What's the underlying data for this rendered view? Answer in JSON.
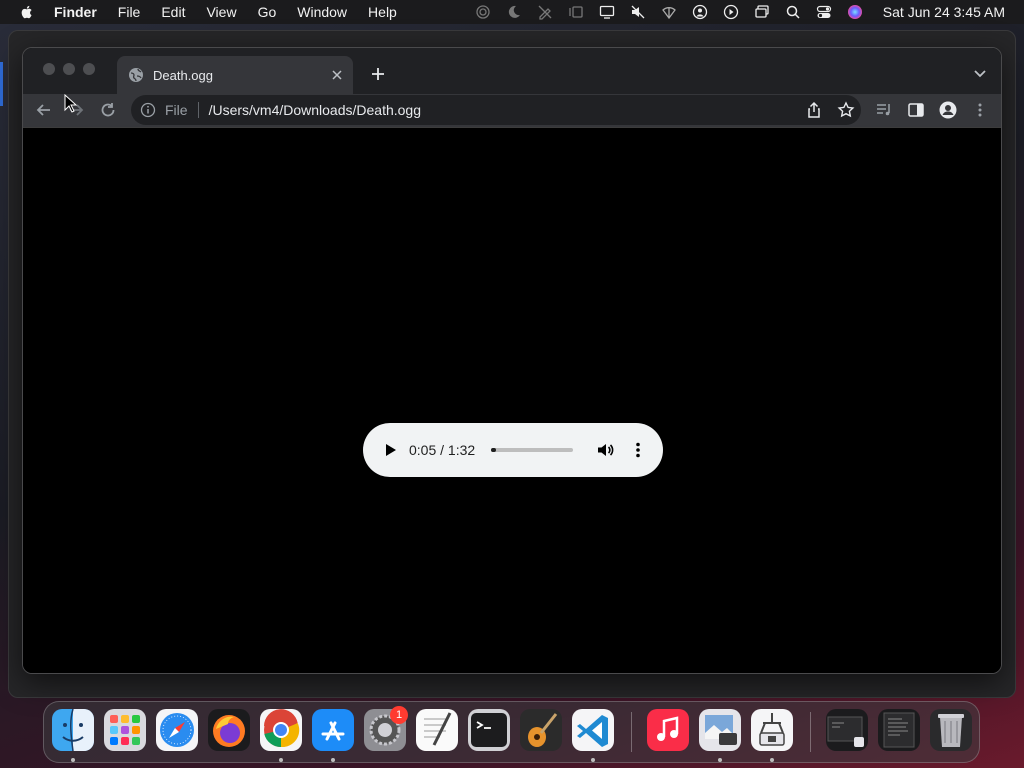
{
  "menubar": {
    "items": [
      "Finder",
      "File",
      "Edit",
      "View",
      "Go",
      "Window",
      "Help"
    ],
    "clock": "Sat Jun 24  3:45 AM",
    "status_icons": [
      "airdrop-icon",
      "focus-moon-icon",
      "pen-off-icon",
      "stage-manager-icon",
      "display-icon",
      "mute-icon",
      "wifi-icon",
      "user-icon",
      "play-circle-icon",
      "screens-icon",
      "search-icon",
      "control-center-icon",
      "siri-icon"
    ]
  },
  "browser": {
    "tab_title": "Death.ogg",
    "omnibox": {
      "scheme": "File",
      "url": "/Users/vm4/Downloads/Death.ogg"
    }
  },
  "player": {
    "time": "0:05 / 1:32",
    "progress": 0.054
  },
  "dock": {
    "apps": [
      "Finder",
      "Launchpad",
      "Safari",
      "Firefox",
      "Google Chrome",
      "App Store",
      "System Settings",
      "TextEdit",
      "Terminal",
      "GarageBand",
      "Visual Studio Code",
      "Music",
      "Preview",
      "Archive Utility",
      "Window 1",
      "Window 2",
      "Trash"
    ],
    "system_settings_badge": "1"
  },
  "colors": {
    "chrome_dark": "#202124",
    "toolbar": "#35363a",
    "player_bg": "#f1f3f4"
  }
}
